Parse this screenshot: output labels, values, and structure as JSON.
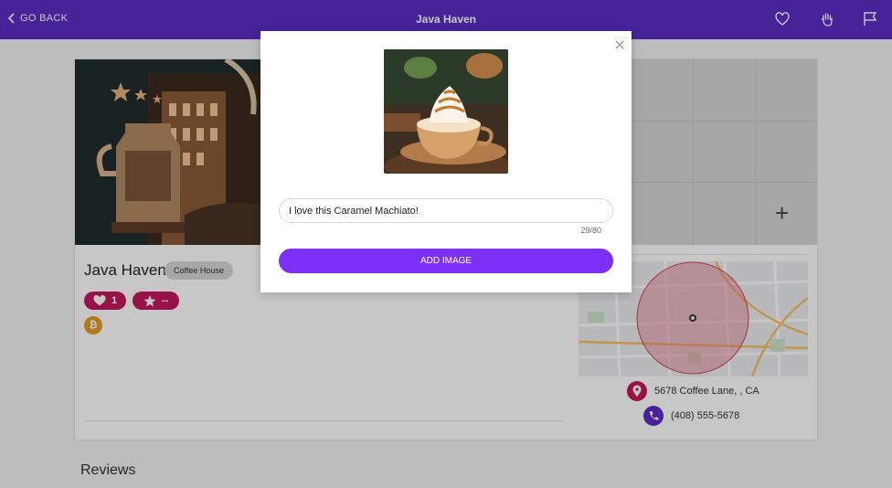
{
  "header": {
    "back_label": "GO BACK",
    "title": "Java Haven",
    "icons": [
      "heart-icon",
      "hand-icon",
      "flag-icon"
    ],
    "color": "#5a2ec4"
  },
  "place": {
    "name": "Java Haven",
    "category": "Coffee House",
    "likes": "1",
    "rating": "--",
    "address": "5678 Coffee Lane, , CA",
    "phone": "(408) 555-5678"
  },
  "reviews": {
    "heading": "Reviews"
  },
  "modal": {
    "caption_value": "I love this Caramel Machiato!",
    "char_count": "29/80",
    "add_button": "ADD IMAGE",
    "accent": "#7b2ff7"
  },
  "colors": {
    "brand": "#5a2ec4",
    "badge": "#c1185b",
    "bitcoin": "#e69b21"
  }
}
